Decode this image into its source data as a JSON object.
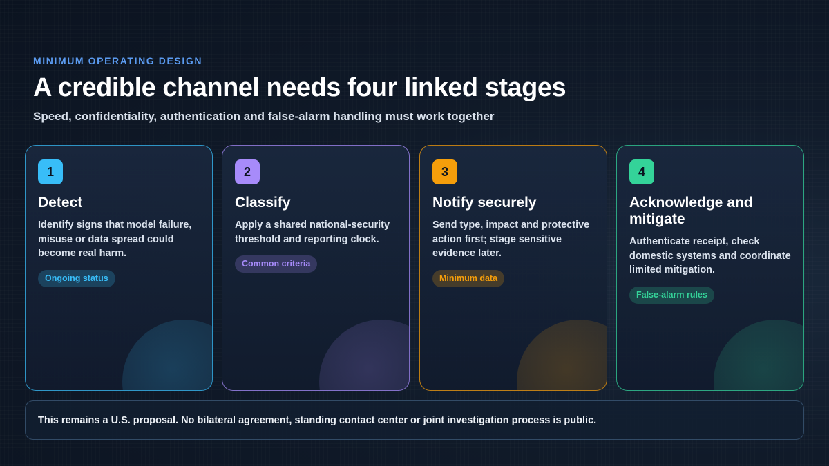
{
  "header": {
    "eyebrow": "MINIMUM OPERATING DESIGN",
    "title": "A credible channel needs four linked stages",
    "subtitle": "Speed, confidentiality, authentication and false-alarm handling must work together"
  },
  "stages": [
    {
      "number": "1",
      "title": "Detect",
      "description": "Identify signs that model failure, misuse or data spread could become real harm.",
      "tag": "Ongoing status",
      "accent": "#38bdf8"
    },
    {
      "number": "2",
      "title": "Classify",
      "description": "Apply a shared national-security threshold and reporting clock.",
      "tag": "Common criteria",
      "accent": "#a78bfa"
    },
    {
      "number": "3",
      "title": "Notify securely",
      "description": "Send type, impact and protective action first; stage sensitive evidence later.",
      "tag": "Minimum data",
      "accent": "#f59e0b"
    },
    {
      "number": "4",
      "title": "Acknowledge and mitigate",
      "description": "Authenticate receipt, check domestic systems and coordinate limited mitigation.",
      "tag": "False-alarm rules",
      "accent": "#34d399"
    }
  ],
  "footer": {
    "note": "This remains a U.S. proposal. No bilateral agreement, standing contact center or joint investigation process is public."
  }
}
